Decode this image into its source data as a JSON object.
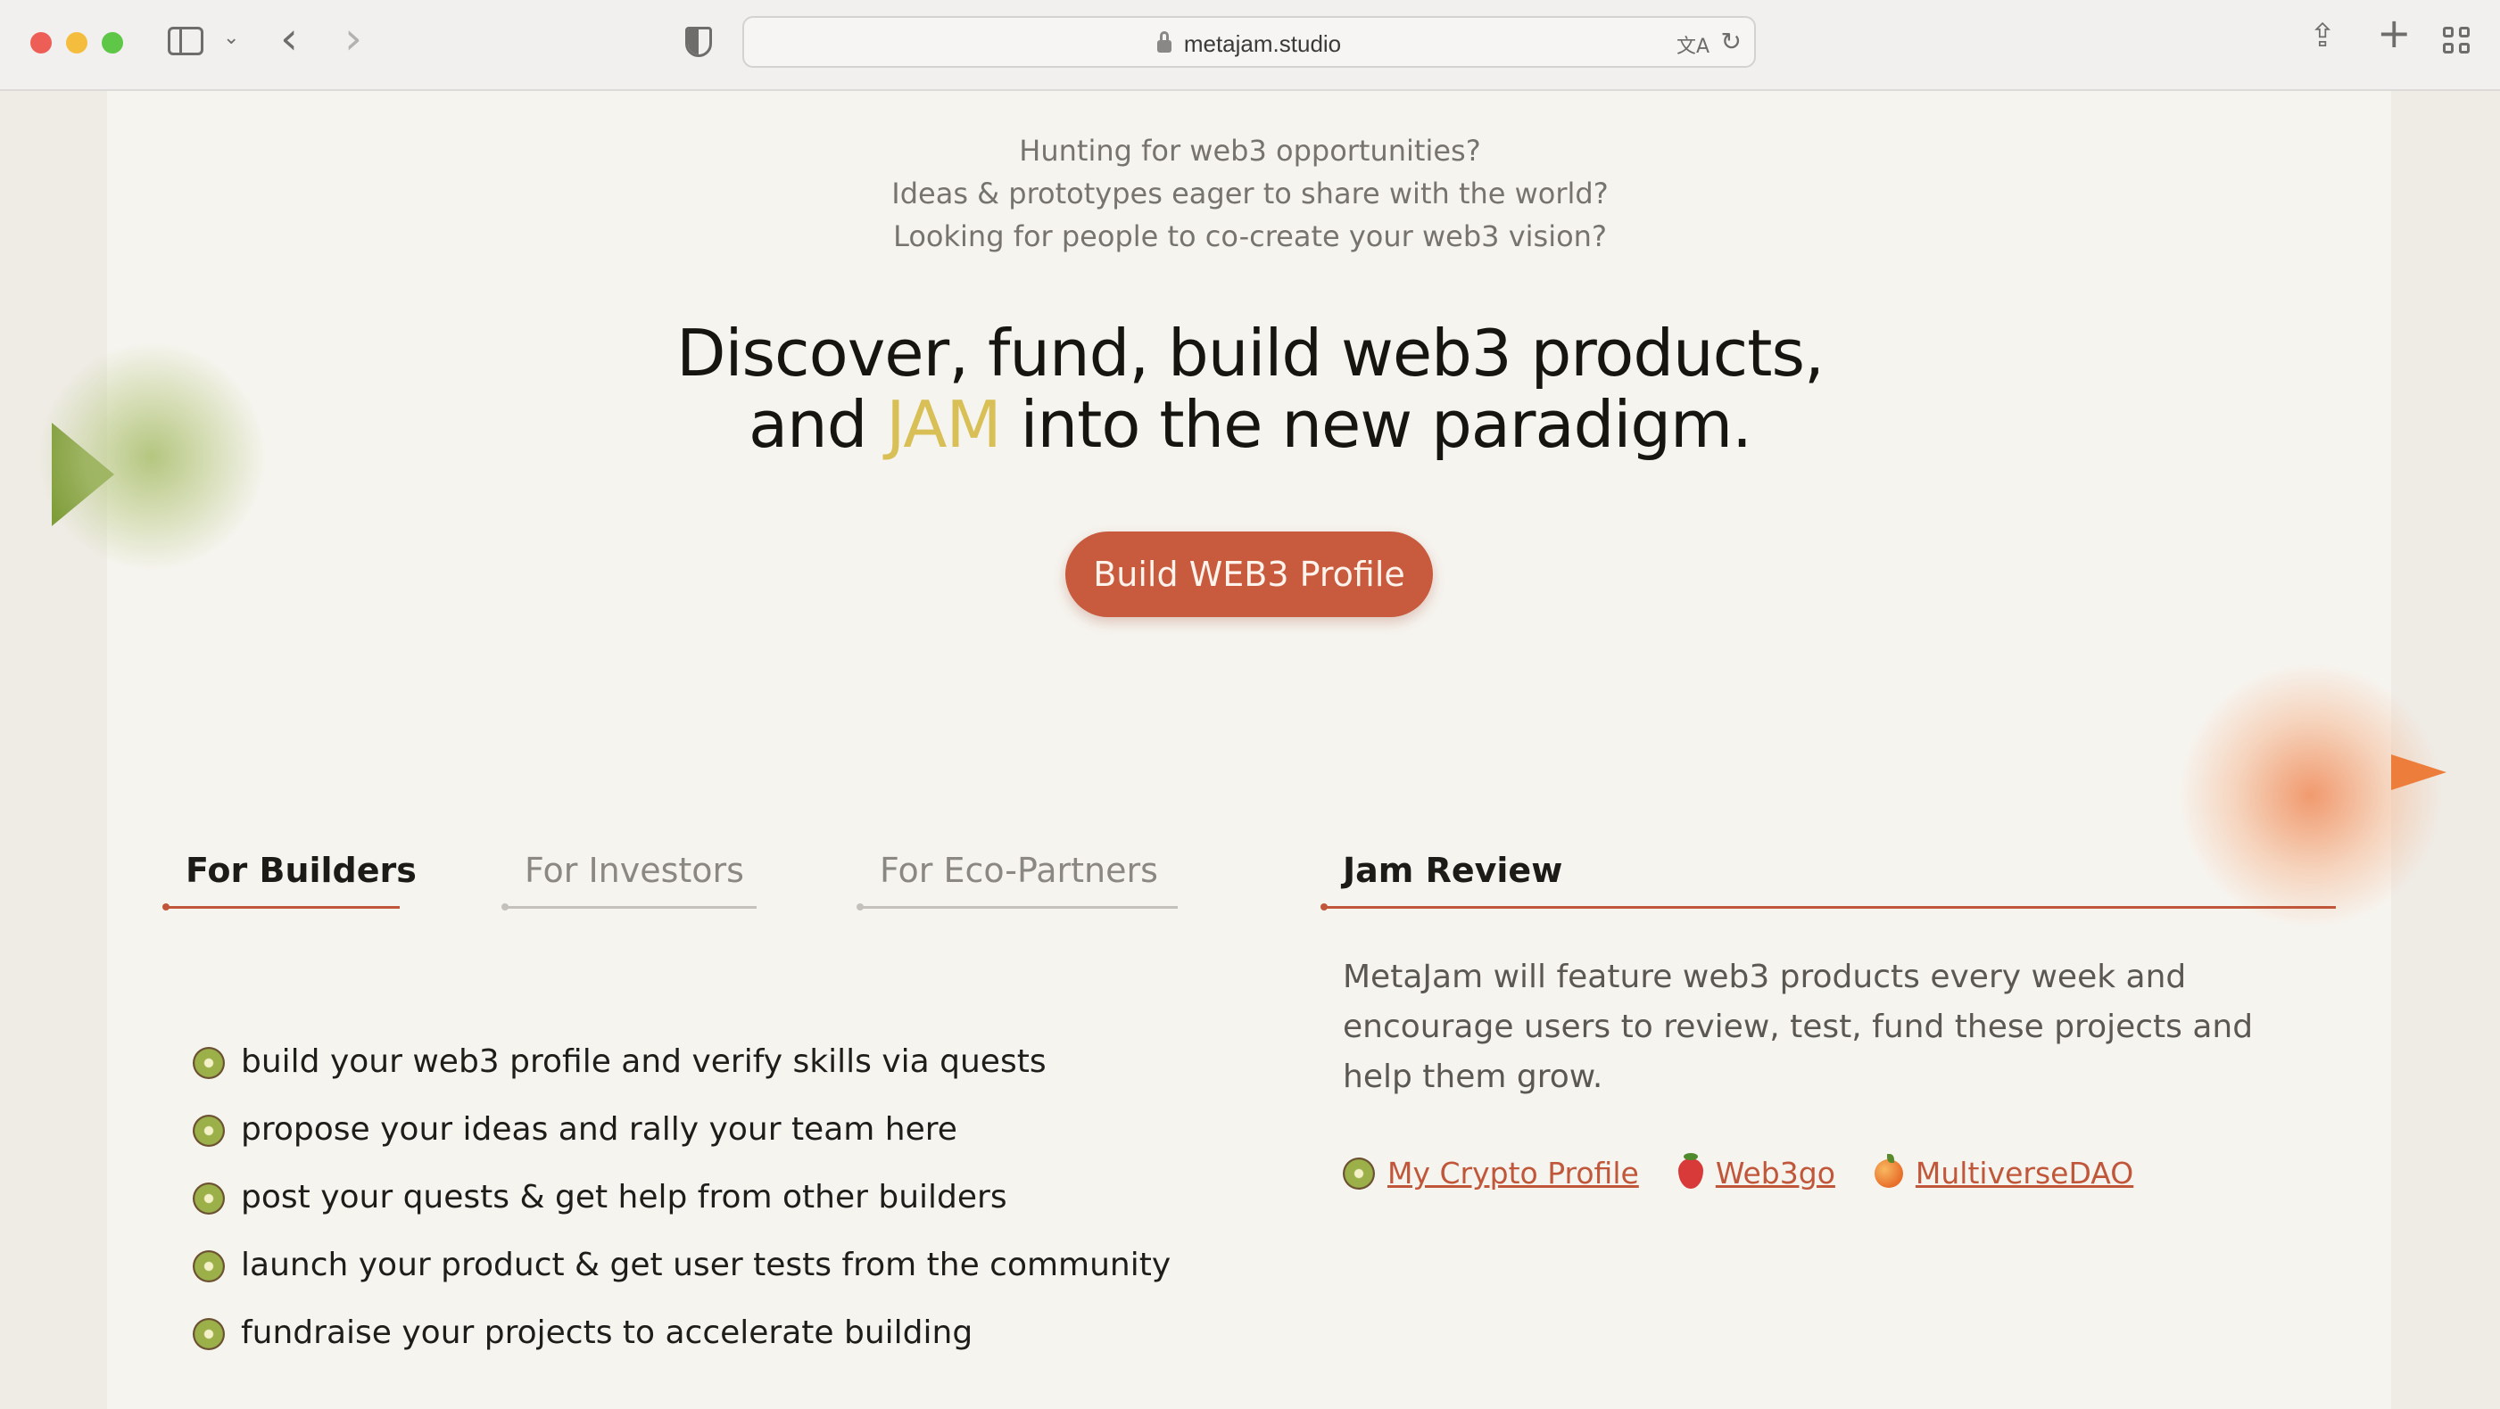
{
  "browser": {
    "url": "metajam.studio"
  },
  "intro": {
    "line1": "Hunting for web3 opportunities?",
    "line2": "Ideas & prototypes eager to share with the world?",
    "line3": "Looking for people to co-create your web3 vision?"
  },
  "hero": {
    "line1": "Discover, fund, build web3 products,",
    "line2_pre": "and ",
    "line2_highlight": "JAM",
    "line2_post": " into the new paradigm.",
    "highlight_color": "#d8bf56"
  },
  "cta": {
    "label": "Build WEB3 Profile",
    "color": "#c85a3e"
  },
  "tabs": [
    {
      "label": "For Builders",
      "active": true
    },
    {
      "label": "For Investors",
      "active": false
    },
    {
      "label": "For Eco-Partners",
      "active": false
    }
  ],
  "builders": {
    "items": [
      "build your web3 profile and verify skills via quests",
      "propose your ideas and rally your team here",
      "post your quests & get help from other builders",
      "launch your product & get user tests from the community",
      "fundraise your projects to accelerate building"
    ],
    "bullet_icon": "kiwi-icon"
  },
  "review": {
    "title": "Jam Review",
    "text": "MetaJam will feature web3 products every week and encourage users to review, test, fund these projects and help them grow.",
    "links": [
      {
        "label": "My Crypto Profile",
        "icon": "kiwi-icon"
      },
      {
        "label": "Web3go",
        "icon": "strawberry-icon"
      },
      {
        "label": "MultiverseDAO",
        "icon": "peach-icon"
      }
    ]
  },
  "accent_color": "#c0573a"
}
